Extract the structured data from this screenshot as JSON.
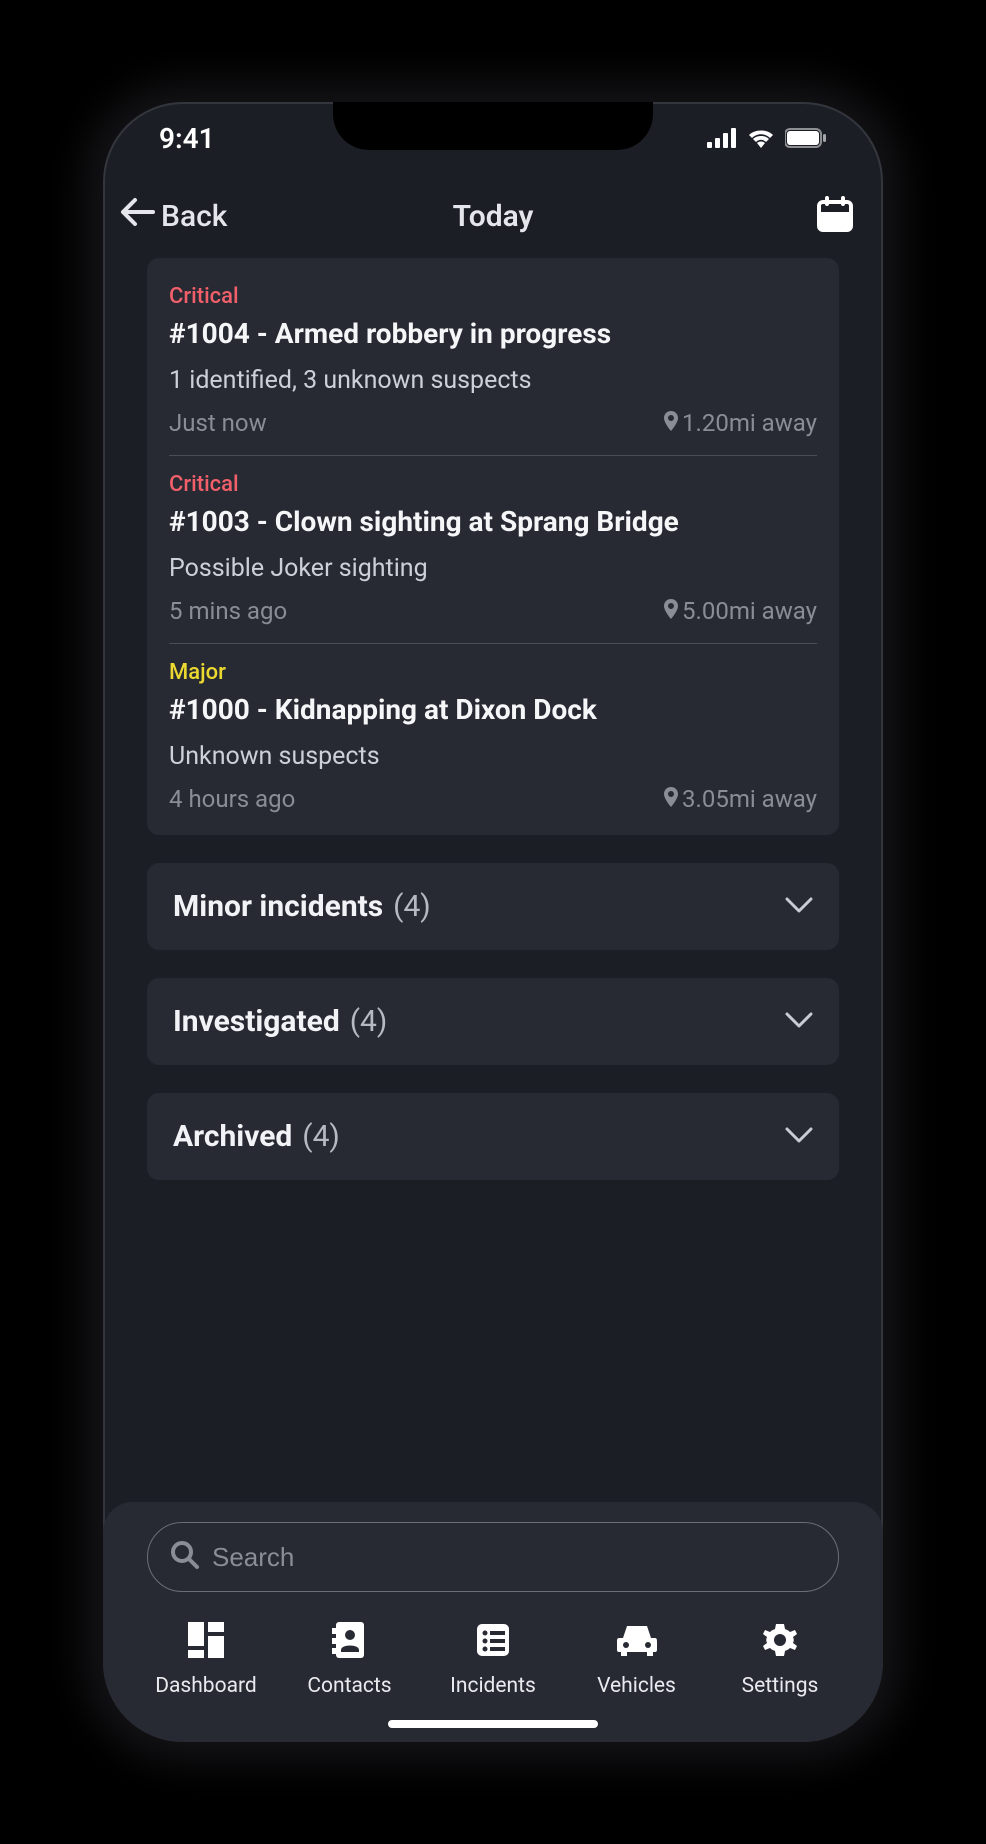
{
  "status": {
    "time": "9:41"
  },
  "nav": {
    "back_label": "Back",
    "title": "Today"
  },
  "open_group": {
    "items": [
      {
        "severity": "Critical",
        "sev_class": "critical",
        "title": "#1004 - Armed robbery in progress",
        "subtitle": "1 identified, 3 unknown suspects",
        "time": "Just now",
        "distance": "1.20mi away"
      },
      {
        "severity": "Critical",
        "sev_class": "critical",
        "title": "#1003 - Clown sighting at Sprang Bridge",
        "subtitle": "Possible Joker sighting",
        "time": "5 mins ago",
        "distance": "5.00mi away"
      },
      {
        "severity": "Major",
        "sev_class": "major",
        "title": "#1000 - Kidnapping at Dixon Dock",
        "subtitle": "Unknown suspects",
        "time": "4 hours ago",
        "distance": "3.05mi away"
      }
    ]
  },
  "accordions": [
    {
      "label": "Minor incidents",
      "count": "(4)"
    },
    {
      "label": "Investigated",
      "count": "(4)"
    },
    {
      "label": "Archived",
      "count": "(4)"
    }
  ],
  "search": {
    "placeholder": "Search"
  },
  "tabs": [
    {
      "label": "Dashboard",
      "icon": "dashboard-icon"
    },
    {
      "label": "Contacts",
      "icon": "contacts-icon"
    },
    {
      "label": "Incidents",
      "icon": "incidents-icon"
    },
    {
      "label": "Vehicles",
      "icon": "vehicles-icon"
    },
    {
      "label": "Settings",
      "icon": "settings-icon"
    }
  ],
  "colors": {
    "bg": "#1b1e25",
    "panel": "#272a33",
    "critical": "#f05f6a",
    "major": "#ecd930",
    "text": "#f5f6f8",
    "muted": "#8a8d95"
  }
}
